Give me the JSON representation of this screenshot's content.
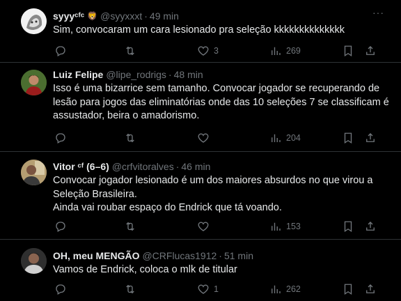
{
  "tweets": [
    {
      "name": "syyyᶜᶠᶜ",
      "emoji": "🦁",
      "handle": "@syyxxxt",
      "time": "49 min",
      "lines": [
        "Sim, convocaram um cara lesionado pra seleção kkkkkkkkkkkkkk"
      ],
      "replies": "",
      "retweets": "",
      "likes": "3",
      "views": "269"
    },
    {
      "name": "Luiz Felipe",
      "handle": "@lipe_rodrigs",
      "time": "48 min",
      "lines": [
        "Isso é uma bizarrice sem tamanho. Convocar jogador se recuperando de",
        "lesão para jogos das eliminatórias onde das 10 seleções 7 se classificam é",
        "assustador, beira o amadorismo."
      ],
      "replies": "",
      "retweets": "",
      "likes": "",
      "views": "204"
    },
    {
      "name": "Vitor ᶜᶠ (6–6)",
      "handle": "@crfvitoralves",
      "time": "46 min",
      "lines": [
        "Convocar jogador lesionado é um dos maiores absurdos no que virou a",
        "Seleção Brasileira.",
        "Ainda vai roubar espaço do Endrick que tá voando."
      ],
      "replies": "",
      "retweets": "",
      "likes": "",
      "views": "153"
    },
    {
      "name": "OH, meu MENGÃO",
      "handle": "@CRFlucas1912",
      "time": "51 min",
      "lines": [
        "Vamos de Endrick, coloca o mlk de titular"
      ],
      "replies": "",
      "retweets": "",
      "likes": "1",
      "views": "262"
    }
  ],
  "ui": {
    "dot": "·",
    "more": "···"
  }
}
